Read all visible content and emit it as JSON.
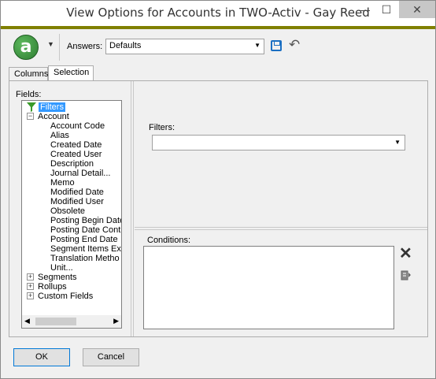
{
  "window": {
    "title": "View Options for Accounts in TWO-Activ - Gay Reed",
    "minimize_glyph": "—",
    "maximize_glyph": "☐",
    "close_glyph": "✕"
  },
  "toolbar": {
    "logo_letter": "a",
    "answers_label": "Answers:",
    "answers_value": "Defaults",
    "dropdown_glyph": "▼",
    "undo_glyph": "↶"
  },
  "tabs": [
    {
      "label": "Columns",
      "active": false
    },
    {
      "label": "Selection",
      "active": true
    }
  ],
  "fields": {
    "label": "Fields:",
    "tree": [
      {
        "label": "Filters",
        "level": 0,
        "icon": "funnel-icon",
        "selected": true
      },
      {
        "label": "Account",
        "level": 0,
        "expander": "−"
      },
      {
        "label": "Account Code",
        "level": 2
      },
      {
        "label": "Alias",
        "level": 2
      },
      {
        "label": "Created Date",
        "level": 2
      },
      {
        "label": "Created User",
        "level": 2
      },
      {
        "label": "Description",
        "level": 2
      },
      {
        "label": "Journal Detail...",
        "level": 2
      },
      {
        "label": "Memo",
        "level": 2
      },
      {
        "label": "Modified Date",
        "level": 2
      },
      {
        "label": "Modified User",
        "level": 2
      },
      {
        "label": "Obsolete",
        "level": 2
      },
      {
        "label": "Posting Begin Date",
        "level": 2
      },
      {
        "label": "Posting Date Cont",
        "level": 2
      },
      {
        "label": "Posting End Date",
        "level": 2
      },
      {
        "label": "Segment Items Ex",
        "level": 2
      },
      {
        "label": "Translation Metho",
        "level": 2
      },
      {
        "label": "Unit...",
        "level": 2
      },
      {
        "label": "Segments",
        "level": 0,
        "expander": "+"
      },
      {
        "label": "Rollups",
        "level": 0,
        "expander": "+"
      },
      {
        "label": "Custom Fields",
        "level": 0,
        "expander": "+"
      }
    ],
    "scroll_left": "◀",
    "scroll_right": "▶"
  },
  "filters": {
    "label": "Filters:",
    "value": "",
    "dropdown_glyph": "▼"
  },
  "conditions": {
    "label": "Conditions:",
    "delete_glyph": "✕"
  },
  "buttons": {
    "ok": "OK",
    "cancel": "Cancel"
  },
  "colors": {
    "accent_bar": "#808000",
    "selection": "#3399ff",
    "logo": "#2e7d32",
    "save_icon": "#1b6fc2"
  }
}
